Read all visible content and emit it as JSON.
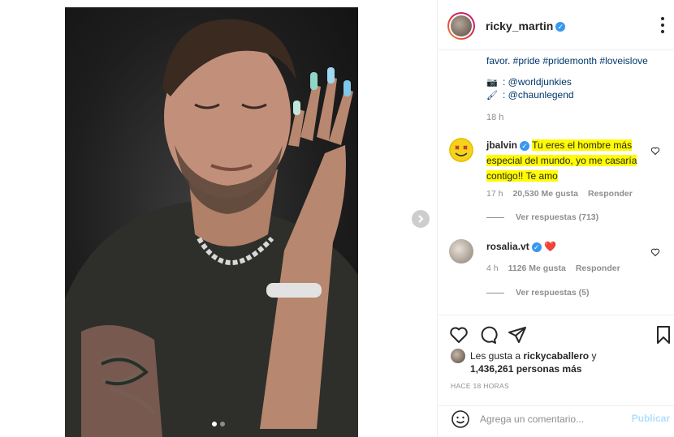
{
  "post": {
    "username": "ricky_martin",
    "caption_tail": "favor. #pride #pridemonth #loveislove",
    "credits": [
      {
        "icon": "camera-emoji",
        "emoji": "📷",
        "text": ": @worldjunkies"
      },
      {
        "icon": "brush-emoji",
        "emoji": "🖌",
        "text": ": @chaunlegend"
      }
    ],
    "caption_time": "18 h"
  },
  "comments": [
    {
      "username": "jbalvin",
      "text": "Tu eres el hombre más especial del mundo, yo me casaría contigo!! Te amo",
      "time": "17 h",
      "likes": "20,530 Me gusta",
      "reply_label": "Responder",
      "view_replies": "Ver respuestas (713)",
      "highlight_color": "#fffb00"
    },
    {
      "username": "rosalia.vt",
      "text": "❤️",
      "time": "4 h",
      "likes": "1126 Me gusta",
      "reply_label": "Responder",
      "view_replies": "Ver respuestas (5)"
    }
  ],
  "likes": {
    "prefix": "Les gusta a",
    "user": "rickycaballero",
    "connector": "y",
    "count": "1,436,261 personas más"
  },
  "post_time": "HACE 18 HORAS",
  "add_comment": {
    "placeholder": "Agrega un comentario...",
    "post_label": "Publicar"
  },
  "colors": {
    "link": "#00376b",
    "verified": "#3897f0",
    "muted": "#8e8e8e",
    "publish_disabled": "#b2dffc",
    "heart_red": "#ed4956"
  }
}
